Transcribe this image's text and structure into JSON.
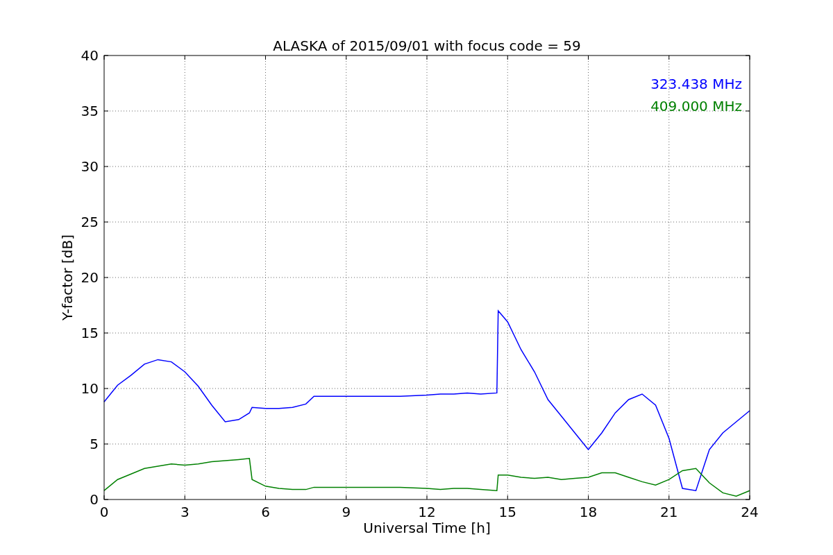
{
  "chart_data": {
    "type": "line",
    "title": "ALASKA of 2015/09/01 with focus code = 59",
    "xlabel": "Universal Time [h]",
    "ylabel": "Y-factor [dB]",
    "x": [
      0,
      0.5,
      1,
      1.5,
      2,
      2.5,
      3,
      3.5,
      4,
      4.5,
      5,
      5.4,
      5.5,
      6,
      6.5,
      7,
      7.5,
      7.8,
      8,
      9,
      10,
      11,
      12,
      12.5,
      13,
      13.5,
      14,
      14.6,
      14.65,
      15,
      15.5,
      16,
      16.5,
      17,
      17.5,
      18,
      18.5,
      19,
      19.5,
      20,
      20.5,
      21,
      21.5,
      22,
      22.5,
      23,
      23.5,
      24
    ],
    "series": [
      {
        "name": "323.438 MHz",
        "color": "#0000ff",
        "values": [
          8.8,
          10.3,
          11.2,
          12.2,
          12.6,
          12.4,
          11.5,
          10.2,
          8.5,
          7.0,
          7.2,
          7.8,
          8.3,
          8.2,
          8.2,
          8.3,
          8.6,
          9.3,
          9.3,
          9.3,
          9.3,
          9.3,
          9.4,
          9.5,
          9.5,
          9.6,
          9.5,
          9.6,
          17.0,
          16.0,
          13.5,
          11.5,
          9.0,
          7.5,
          6.0,
          4.5,
          6.0,
          7.8,
          9.0,
          9.5,
          8.5,
          5.5,
          1.0,
          0.8,
          4.5,
          6.0,
          7.0,
          8.0
        ]
      },
      {
        "name": "409.000 MHz",
        "color": "#008000",
        "values": [
          0.8,
          1.8,
          2.3,
          2.8,
          3.0,
          3.2,
          3.1,
          3.2,
          3.4,
          3.5,
          3.6,
          3.7,
          1.8,
          1.2,
          1.0,
          0.9,
          0.9,
          1.1,
          1.1,
          1.1,
          1.1,
          1.1,
          1.0,
          0.9,
          1.0,
          1.0,
          0.9,
          0.8,
          2.2,
          2.2,
          2.0,
          1.9,
          2.0,
          1.8,
          1.9,
          2.0,
          2.4,
          2.4,
          2.0,
          1.6,
          1.3,
          1.8,
          2.6,
          2.8,
          1.5,
          0.6,
          0.3,
          0.8
        ]
      }
    ],
    "xlim": [
      0,
      24
    ],
    "ylim": [
      0,
      40
    ],
    "xticks": [
      0,
      3,
      6,
      9,
      12,
      15,
      18,
      21,
      24
    ],
    "yticks": [
      0,
      5,
      10,
      15,
      20,
      25,
      30,
      35,
      40
    ],
    "grid": true
  }
}
